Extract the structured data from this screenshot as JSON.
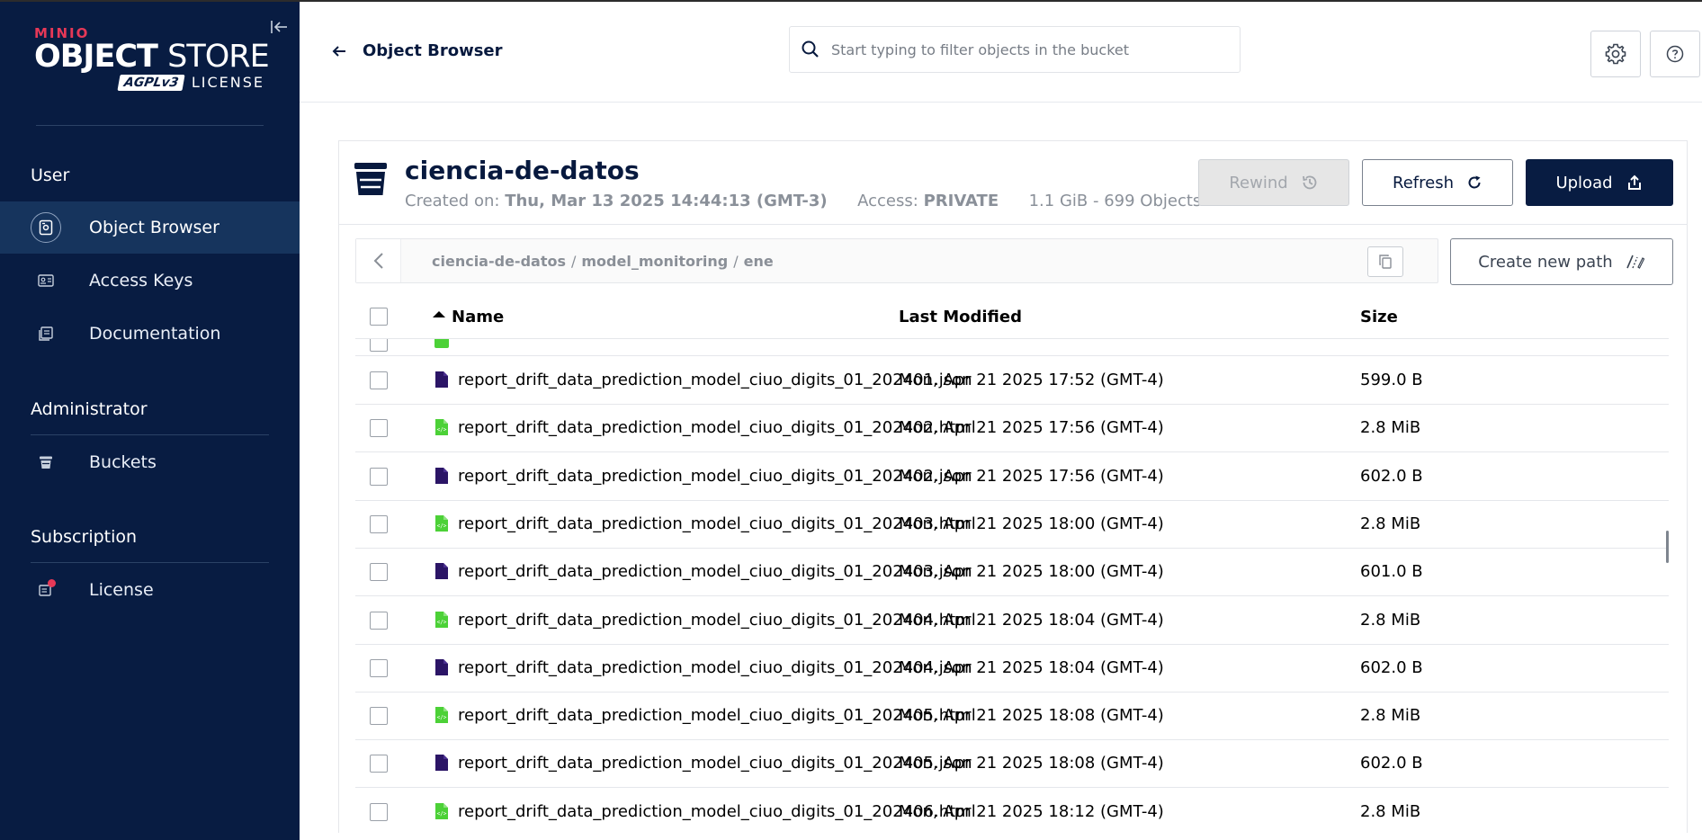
{
  "brand": {
    "minio": "MINIO",
    "product_bold": "OBJECT",
    "product_thin": "STORE",
    "agpl": "AGPLv3",
    "license": "LICENSE"
  },
  "sidebar": {
    "sections": [
      {
        "title": "User",
        "items": [
          {
            "label": "Object Browser",
            "icon": "object-browser-icon",
            "active": true
          },
          {
            "label": "Access Keys",
            "icon": "access-keys-icon"
          },
          {
            "label": "Documentation",
            "icon": "documentation-icon"
          }
        ]
      },
      {
        "title": "Administrator",
        "items": [
          {
            "label": "Buckets",
            "icon": "bucket-icon"
          }
        ]
      },
      {
        "title": "Subscription",
        "items": [
          {
            "label": "License",
            "icon": "license-icon"
          }
        ]
      }
    ]
  },
  "header": {
    "back_label": "Object Browser",
    "search_placeholder": "Start typing to filter objects in the bucket"
  },
  "bucket": {
    "name": "ciencia-de-datos",
    "created_label": "Created on:",
    "created_value": "Thu, Mar 13 2025 14:44:13 (GMT-3)",
    "access_label": "Access:",
    "access_value": "PRIVATE",
    "usage": "1.1 GiB - 699 Objects"
  },
  "actions": {
    "rewind": "Rewind",
    "refresh": "Refresh",
    "upload": "Upload",
    "create_path": "Create new path"
  },
  "breadcrumb": {
    "parts": [
      "ciencia-de-datos",
      "model_monitoring",
      "ene"
    ],
    "separator": "/"
  },
  "table": {
    "columns": {
      "name": "Name",
      "modified": "Last Modified",
      "size": "Size"
    },
    "rows": [
      {
        "name": "report_drift_data_prediction_model_ciuo_digits_01_202401.json",
        "modified": "Mon, Apr 21 2025 17:52 (GMT-4)",
        "size": "599.0 B",
        "type": "json"
      },
      {
        "name": "report_drift_data_prediction_model_ciuo_digits_01_202402.html",
        "modified": "Mon, Apr 21 2025 17:56 (GMT-4)",
        "size": "2.8 MiB",
        "type": "html"
      },
      {
        "name": "report_drift_data_prediction_model_ciuo_digits_01_202402.json",
        "modified": "Mon, Apr 21 2025 17:56 (GMT-4)",
        "size": "602.0 B",
        "type": "json"
      },
      {
        "name": "report_drift_data_prediction_model_ciuo_digits_01_202403.html",
        "modified": "Mon, Apr 21 2025 18:00 (GMT-4)",
        "size": "2.8 MiB",
        "type": "html"
      },
      {
        "name": "report_drift_data_prediction_model_ciuo_digits_01_202403.json",
        "modified": "Mon, Apr 21 2025 18:00 (GMT-4)",
        "size": "601.0 B",
        "type": "json"
      },
      {
        "name": "report_drift_data_prediction_model_ciuo_digits_01_202404.html",
        "modified": "Mon, Apr 21 2025 18:04 (GMT-4)",
        "size": "2.8 MiB",
        "type": "html"
      },
      {
        "name": "report_drift_data_prediction_model_ciuo_digits_01_202404.json",
        "modified": "Mon, Apr 21 2025 18:04 (GMT-4)",
        "size": "602.0 B",
        "type": "json"
      },
      {
        "name": "report_drift_data_prediction_model_ciuo_digits_01_202405.html",
        "modified": "Mon, Apr 21 2025 18:08 (GMT-4)",
        "size": "2.8 MiB",
        "type": "html"
      },
      {
        "name": "report_drift_data_prediction_model_ciuo_digits_01_202405.json",
        "modified": "Mon, Apr 21 2025 18:08 (GMT-4)",
        "size": "602.0 B",
        "type": "json"
      },
      {
        "name": "report_drift_data_prediction_model_ciuo_digits_01_202406.html",
        "modified": "Mon, Apr 21 2025 18:12 (GMT-4)",
        "size": "2.8 MiB",
        "type": "html"
      }
    ]
  },
  "colors": {
    "sidebar_bg": "#081c42",
    "sidebar_active": "#16345d",
    "accent_red": "#e63857",
    "html_file": "#4cd137",
    "json_file": "#2b1566",
    "upload_bg": "#081c42"
  }
}
